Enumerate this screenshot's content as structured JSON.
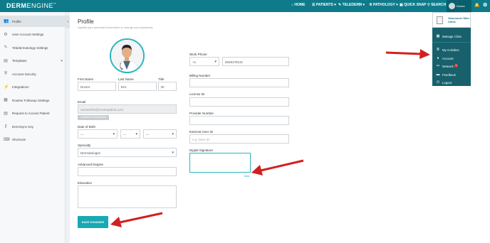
{
  "brand": {
    "name_bold": "DERM",
    "name_light": "ENGINE",
    "tm": "™"
  },
  "topnav": {
    "home": "HOME",
    "patients": "PATIENTS",
    "teledermatology": "TELEDERM",
    "pathology": "PATHOLOGY",
    "quick_snap": "QUICK SNAP",
    "search": "SEARCH",
    "user": "Doctor"
  },
  "sidebar": {
    "items": [
      {
        "label": "Profile",
        "icon": "user-group-icon"
      },
      {
        "label": "User Account Settings",
        "icon": "gear-icon"
      },
      {
        "label": "Teledermatology Settings",
        "icon": "pencil-icon"
      },
      {
        "label": "Templates",
        "icon": "document-icon"
      },
      {
        "label": "Account Security",
        "icon": "shield-icon"
      },
      {
        "label": "Integrations",
        "icon": "plug-icon"
      },
      {
        "label": "Routine Followup Settings",
        "icon": "calendar-icon"
      },
      {
        "label": "Request to Access Patient",
        "icon": "document-icon"
      },
      {
        "label": "DermSync Key",
        "icon": "key-icon"
      },
      {
        "label": "Shortcuts",
        "icon": "keyboard-icon"
      }
    ]
  },
  "profile": {
    "title": "Profile",
    "subtitle": "Update your personal information or change your password.",
    "first_name_label": "First Name",
    "first_name": "Doctor",
    "last_name_label": "Last Name",
    "last_name": "Eric",
    "title_label": "Title",
    "title_value": "Dr.",
    "email_label": "Email",
    "email": "rachaelmh@medeaptima.com",
    "change_password": "CHANGE PASSWORD",
    "dob_label": "Date of Birth",
    "dob_day": "---",
    "dob_month": "---",
    "dob_year": "---",
    "specialty_label": "Specialty",
    "specialty": "Dermatologist",
    "advanced_degree_label": "Advanced Degree",
    "education_label": "Education",
    "save": "SAVE CHANGES",
    "work_phone_label": "Work Phone",
    "phone_code": "+1",
    "phone": "6048179131",
    "billing_label": "Billing Number",
    "license_label": "License ID",
    "provider_label": "Provider Number",
    "external_label": "External User ID",
    "external_placeholder": "e.g. Dam ID",
    "signature_label": "Digital Signature",
    "add": "Add"
  },
  "dropdown": {
    "clinic": "Vancouver Skin Clinic",
    "items": [
      {
        "label": "Manage Clinic",
        "icon": "building-icon"
      },
      {
        "label": "My Activities",
        "icon": "list-icon"
      },
      {
        "label": "Account",
        "icon": "user-icon"
      },
      {
        "label": "Network",
        "icon": "network-icon",
        "badge": "1"
      },
      {
        "label": "Feedback",
        "icon": "comment-icon"
      },
      {
        "label": "Logout",
        "icon": "power-icon"
      }
    ]
  },
  "colors": {
    "header": "#0e7a8a",
    "accent": "#18a9b5",
    "dropdown": "#17606c",
    "arrow": "#d31f1f"
  }
}
